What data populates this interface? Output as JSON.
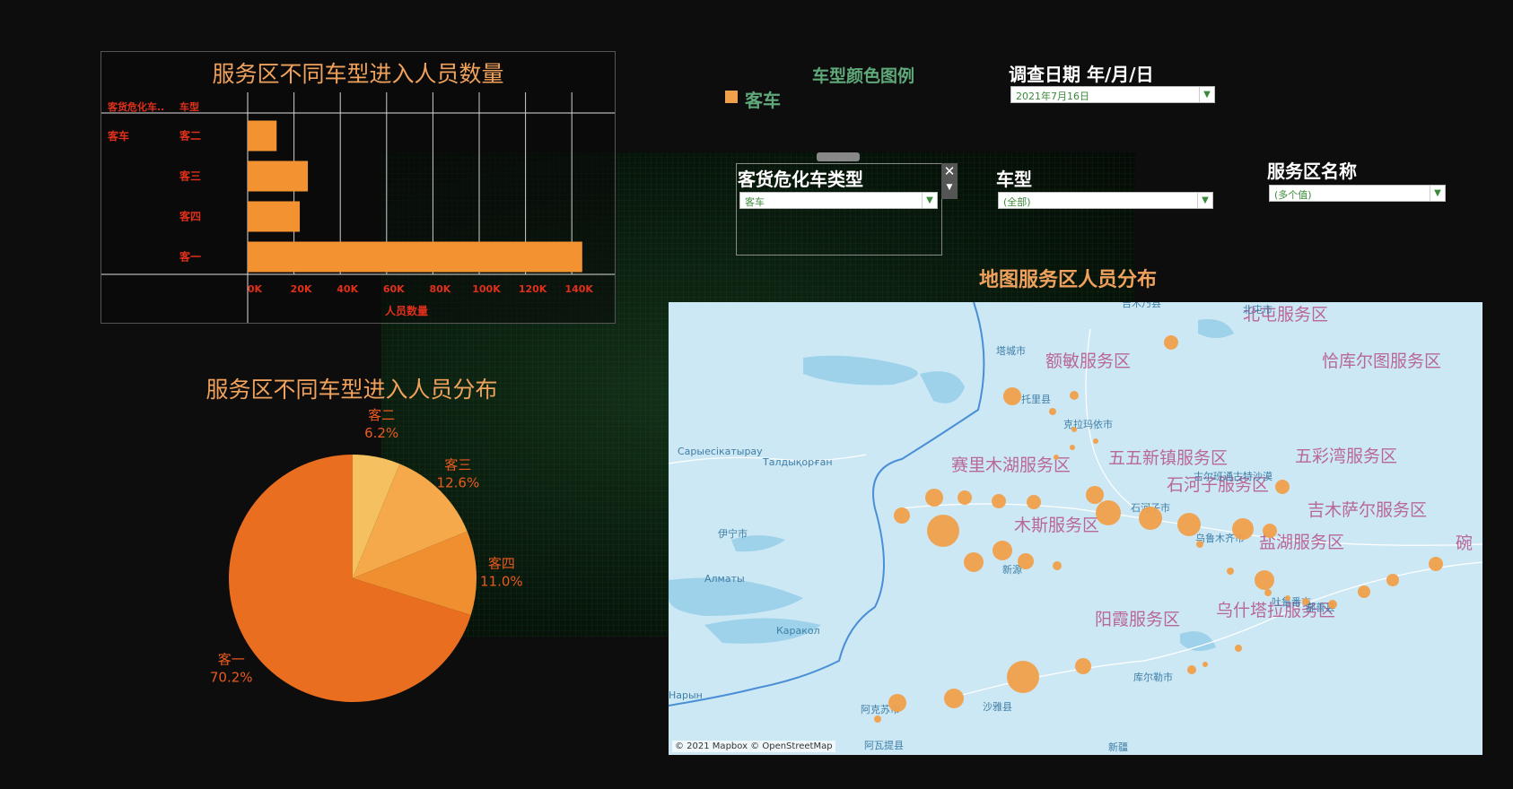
{
  "bar_chart": {
    "title": "服务区不同车型进入人员数量",
    "col_header_1": "客货危化车..",
    "col_header_2": "车型",
    "group_label": "客车",
    "xlabel": "人员数量"
  },
  "pie_chart": {
    "title": "服务区不同车型进入人员分布"
  },
  "legend": {
    "title": "车型颜色图例",
    "item_label": "客车",
    "item_color": "#f0a04b"
  },
  "filters": {
    "date": {
      "title": "调查日期 年/月/日",
      "value": "2021年7月16日"
    },
    "vehicle_category": {
      "title": "客货危化车类型",
      "value": "客车"
    },
    "vehicle_type": {
      "title": "车型",
      "value": "(全部)"
    },
    "service_area": {
      "title": "服务区名称",
      "value": "(多个值)"
    }
  },
  "map": {
    "title": "地图服务区人员分布",
    "attribution": "© 2021 Mapbox © OpenStreetMap",
    "service_area_labels": [
      "北屯服务区",
      "额敏服务区",
      "恰库尔图服务区",
      "五五新镇服务区",
      "赛里木湖服务区",
      "五彩湾服务区",
      "石河子服务区",
      "吉木萨尔服务区",
      "木斯服务区",
      "盐湖服务区",
      "阳霞服务区",
      "乌什塔拉服务区",
      "碗"
    ],
    "city_labels": [
      "塔城市",
      "托里县",
      "克拉玛依市",
      "古尔班通古特沙漠",
      "石河子市",
      "乌鲁木齐市",
      "伊宁市",
      "新源",
      "吐鲁番市",
      "鄯善县",
      "库尔勒市",
      "沙雅县",
      "阿克苏市",
      "阿瓦提县",
      "新疆",
      "Сарыесікатырау",
      "Талдықорған",
      "Алматы",
      "Каракол",
      "Нарын",
      "吉木乃县",
      "北屯市"
    ]
  },
  "chart_data": [
    {
      "type": "bar",
      "orientation": "horizontal",
      "title": "服务区不同车型进入人员数量",
      "categories": [
        "客二",
        "客三",
        "客四",
        "客一"
      ],
      "values": [
        12500,
        26000,
        22500,
        144500
      ],
      "xlabel": "人员数量",
      "ylabel": "车型",
      "xlim": [
        0,
        150000
      ],
      "xticks": [
        "0K",
        "20K",
        "40K",
        "60K",
        "80K",
        "100K",
        "120K",
        "140K"
      ],
      "grid": true,
      "color": "#f29231"
    },
    {
      "type": "pie",
      "title": "服务区不同车型进入人员分布",
      "labels": [
        "客二",
        "客三",
        "客四",
        "客一"
      ],
      "percent_labels": [
        "6.2%",
        "12.6%",
        "11.0%",
        "70.2%"
      ],
      "values": [
        6.2,
        12.6,
        11.0,
        70.2
      ],
      "colors": [
        "#f5c05f",
        "#f5a94a",
        "#f08f2f",
        "#ea6e1f"
      ]
    }
  ]
}
